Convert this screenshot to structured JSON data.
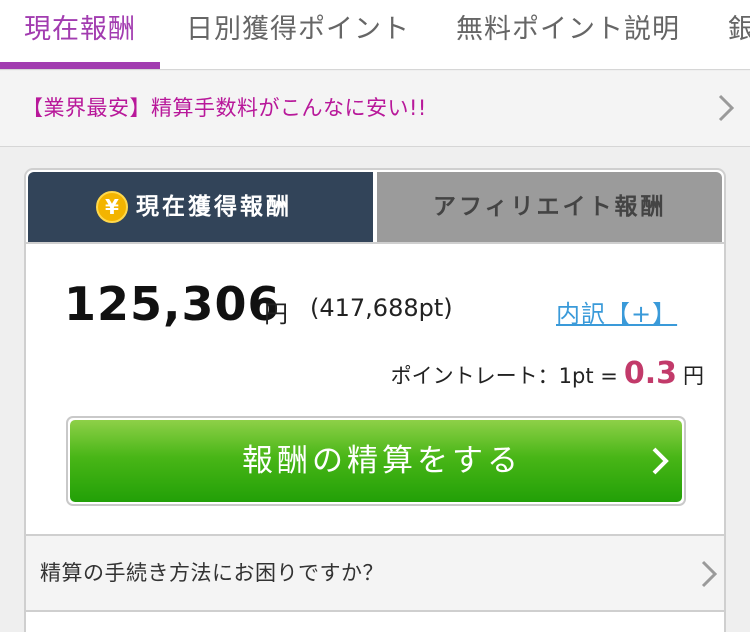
{
  "topnav": {
    "tabs": [
      {
        "label": "現在報酬"
      },
      {
        "label": "日別獲得ポイント"
      },
      {
        "label": "無料ポイント説明"
      },
      {
        "label": "銀"
      }
    ],
    "active_color": "#a23cb0"
  },
  "promo": {
    "text": "【業界最安】精算手数料がこんなに安い!!"
  },
  "card": {
    "tabs": {
      "current": {
        "label": "現在獲得報酬",
        "icon": "yen-coin-icon",
        "icon_glyph": "¥"
      },
      "affiliate": {
        "label": "アフィリエイト報酬"
      }
    },
    "amount": "125,306",
    "amount_unit": "円",
    "points": "(417,688pt)",
    "breakdown_link": "内訳【+】",
    "rate": {
      "label": "ポイントレート：1pt =",
      "value": "0.3",
      "unit": "円"
    },
    "pay_button": {
      "label": "報酬の精算をする"
    },
    "help": {
      "text": "精算の手続き方法にお困りですか？"
    }
  },
  "colors": {
    "accent": "#a23cb0",
    "promo_text": "#b8189a",
    "active_tab_bg": "#324459",
    "inactive_tab_bg": "#9b9b9b",
    "rate_value": "#c23a6a",
    "link": "#3a9ad9",
    "button_green": "#49b617"
  }
}
